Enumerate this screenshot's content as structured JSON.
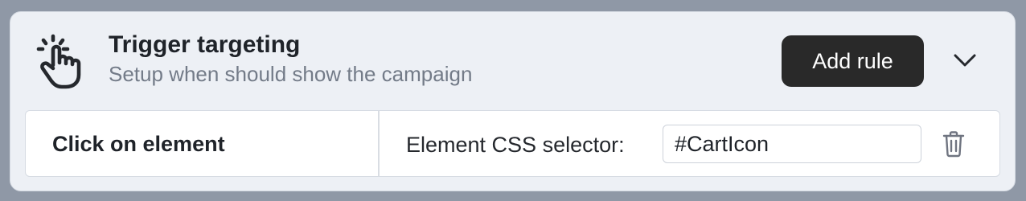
{
  "header": {
    "title": "Trigger targeting",
    "subtitle": "Setup when should show the campaign",
    "add_rule_label": "Add rule",
    "icon": "tap-hand-icon",
    "toggle_icon": "chevron-down-icon"
  },
  "rule": {
    "type_label": "Click on element",
    "selector_label": "Element CSS selector:",
    "selector_value": "#CartIcon",
    "delete_icon": "trash-icon"
  },
  "colors": {
    "page_bg": "#8f98a6",
    "panel_bg": "#edf0f5",
    "button_bg": "#292929",
    "subtitle_text": "#737b88"
  }
}
